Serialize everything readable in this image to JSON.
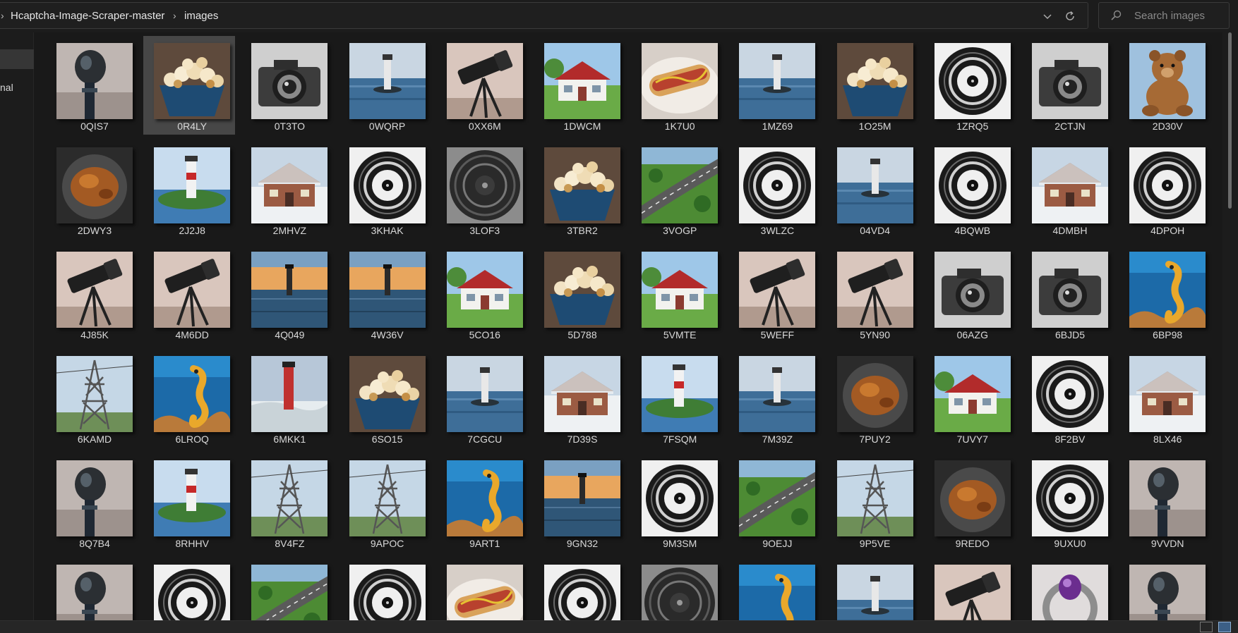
{
  "window": {
    "view": "extra-large-icons"
  },
  "address_bar": {
    "breadcrumbs": [
      "Hcaptcha-Image-Scraper-master",
      "images"
    ],
    "separator_icon": "chevron-right-icon",
    "history_icon": "chevron-down-icon",
    "refresh_icon": "refresh-icon"
  },
  "search": {
    "placeholder": "Search images",
    "value": "",
    "icon": "search-icon"
  },
  "nav_pane": {
    "visible_label": "nal"
  },
  "files": [
    {
      "name": "0QIS7",
      "kind": "mic"
    },
    {
      "name": "0R4LY",
      "kind": "popcorn",
      "selected": true
    },
    {
      "name": "0T3TO",
      "kind": "camera"
    },
    {
      "name": "0WQRP",
      "kind": "lighthouse_sea"
    },
    {
      "name": "0XX6M",
      "kind": "telescope"
    },
    {
      "name": "1DWCM",
      "kind": "house"
    },
    {
      "name": "1K7U0",
      "kind": "hotdog"
    },
    {
      "name": "1MZ69",
      "kind": "lighthouse_sea"
    },
    {
      "name": "1O25M",
      "kind": "popcorn"
    },
    {
      "name": "1ZRQ5",
      "kind": "record"
    },
    {
      "name": "2CTJN",
      "kind": "camera"
    },
    {
      "name": "2D30V",
      "kind": "bear"
    },
    {
      "name": "2DWY3",
      "kind": "chicken"
    },
    {
      "name": "2J2J8",
      "kind": "lighthouse_green"
    },
    {
      "name": "2MHVZ",
      "kind": "house_snow"
    },
    {
      "name": "3KHAK",
      "kind": "record"
    },
    {
      "name": "3LOF3",
      "kind": "record_dark"
    },
    {
      "name": "3TBR2",
      "kind": "popcorn"
    },
    {
      "name": "3VOGP",
      "kind": "road"
    },
    {
      "name": "3WLZC",
      "kind": "record"
    },
    {
      "name": "04VD4",
      "kind": "lighthouse_sea"
    },
    {
      "name": "4BQWB",
      "kind": "record"
    },
    {
      "name": "4DMBH",
      "kind": "house_snow"
    },
    {
      "name": "4DPOH",
      "kind": "record"
    },
    {
      "name": "4J85K",
      "kind": "telescope"
    },
    {
      "name": "4M6DD",
      "kind": "telescope"
    },
    {
      "name": "4Q049",
      "kind": "lighthouse_sunset"
    },
    {
      "name": "4W36V",
      "kind": "lighthouse_sunset"
    },
    {
      "name": "5CO16",
      "kind": "house"
    },
    {
      "name": "5D788",
      "kind": "popcorn"
    },
    {
      "name": "5VMTE",
      "kind": "house"
    },
    {
      "name": "5WEFF",
      "kind": "telescope"
    },
    {
      "name": "5YN90",
      "kind": "telescope"
    },
    {
      "name": "06AZG",
      "kind": "camera"
    },
    {
      "name": "6BJD5",
      "kind": "camera"
    },
    {
      "name": "6BP98",
      "kind": "seahorse"
    },
    {
      "name": "6KAMD",
      "kind": "pylon"
    },
    {
      "name": "6LROQ",
      "kind": "seahorse"
    },
    {
      "name": "6MKK1",
      "kind": "lighthouse_red"
    },
    {
      "name": "6SO15",
      "kind": "popcorn"
    },
    {
      "name": "7CGCU",
      "kind": "lighthouse_sea"
    },
    {
      "name": "7D39S",
      "kind": "house_snow"
    },
    {
      "name": "7FSQM",
      "kind": "lighthouse_green"
    },
    {
      "name": "7M39Z",
      "kind": "lighthouse_sea"
    },
    {
      "name": "7PUY2",
      "kind": "chicken"
    },
    {
      "name": "7UVY7",
      "kind": "house"
    },
    {
      "name": "8F2BV",
      "kind": "record"
    },
    {
      "name": "8LX46",
      "kind": "house_snow"
    },
    {
      "name": "8Q7B4",
      "kind": "mic"
    },
    {
      "name": "8RHHV",
      "kind": "lighthouse_green"
    },
    {
      "name": "8V4FZ",
      "kind": "pylon"
    },
    {
      "name": "9APOC",
      "kind": "pylon"
    },
    {
      "name": "9ART1",
      "kind": "seahorse"
    },
    {
      "name": "9GN32",
      "kind": "lighthouse_sunset"
    },
    {
      "name": "9M3SM",
      "kind": "record"
    },
    {
      "name": "9OEJJ",
      "kind": "road"
    },
    {
      "name": "9P5VE",
      "kind": "pylon"
    },
    {
      "name": "9REDO",
      "kind": "chicken"
    },
    {
      "name": "9UXU0",
      "kind": "record"
    },
    {
      "name": "9VVDN",
      "kind": "mic"
    },
    {
      "name": "",
      "kind": "mic"
    },
    {
      "name": "",
      "kind": "record"
    },
    {
      "name": "",
      "kind": "road"
    },
    {
      "name": "",
      "kind": "record"
    },
    {
      "name": "",
      "kind": "hotdog"
    },
    {
      "name": "",
      "kind": "record"
    },
    {
      "name": "",
      "kind": "record_dark"
    },
    {
      "name": "",
      "kind": "seahorse"
    },
    {
      "name": "",
      "kind": "lighthouse_sea"
    },
    {
      "name": "",
      "kind": "telescope"
    },
    {
      "name": "",
      "kind": "ring"
    },
    {
      "name": "",
      "kind": "mic"
    }
  ],
  "status_bar": {
    "views": [
      "details-view-icon",
      "large-icons-view-icon"
    ],
    "active_view": 1
  },
  "colors": {
    "background": "#191919",
    "selected_tile": "#474747",
    "text": "#d9d9d9",
    "accent": "#3c5f86"
  }
}
